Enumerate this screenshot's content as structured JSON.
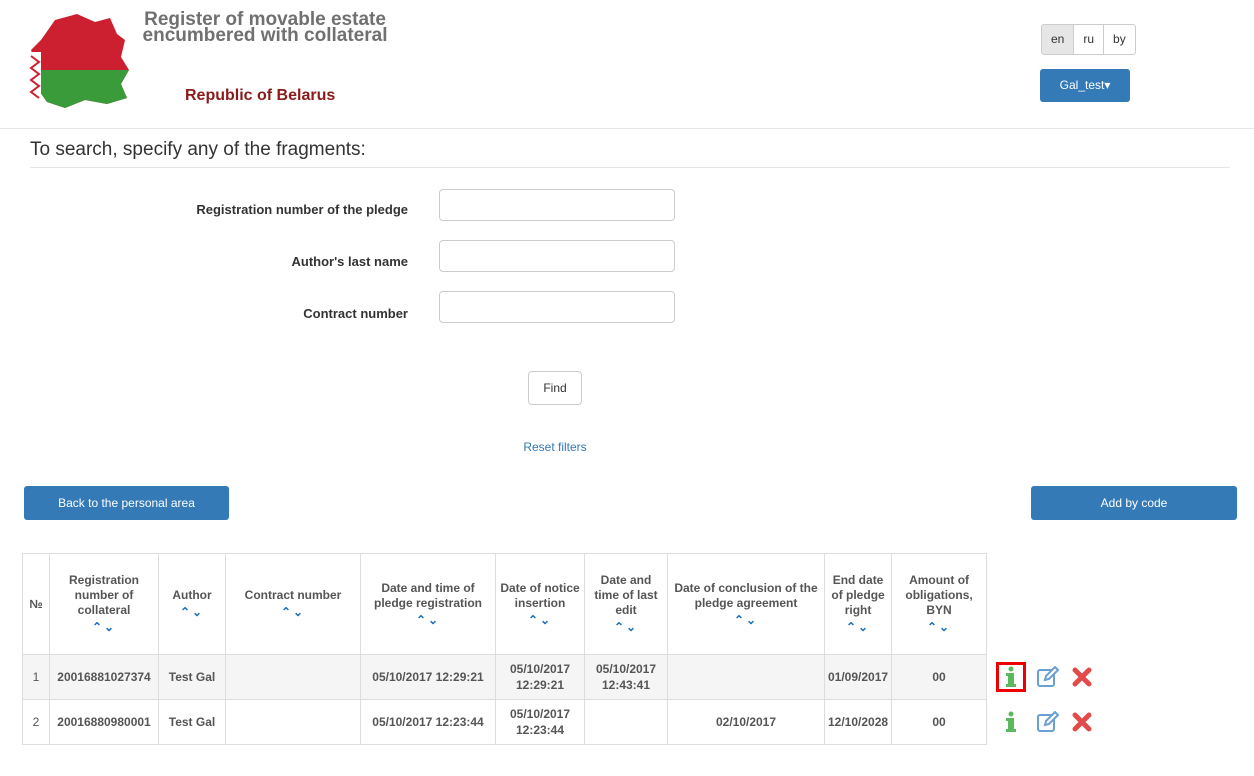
{
  "header": {
    "title": "Register of movable estate encumbered with collateral",
    "subtitle": "Republic of Belarus",
    "languages": [
      "en",
      "ru",
      "by"
    ],
    "active_language": "en",
    "user_button": "Gal_test▾"
  },
  "search": {
    "heading": "To search, specify any of the fragments:",
    "fields": [
      {
        "label": "Registration number of the pledge",
        "value": ""
      },
      {
        "label": "Author's last name",
        "value": ""
      },
      {
        "label": "Contract number",
        "value": ""
      }
    ],
    "find_label": "Find",
    "reset_label": "Reset filters"
  },
  "actions": {
    "back_label": "Back to the personal area",
    "add_label": "Add by code"
  },
  "table": {
    "columns": [
      "№",
      "Registration number of collateral",
      "Author",
      "Contract number",
      "Date and time of pledge registration",
      "Date of notice insertion",
      "Date and time of last edit",
      "Date of conclusion of the pledge agreement",
      "End date of pledge right",
      "Amount of obligations, BYN"
    ],
    "sort_glyph": "⌃⌄",
    "rows": [
      {
        "no": "1",
        "reg_number": "20016881027374",
        "author": "Test Gal",
        "contract_number": "",
        "reg_date": "05/10/2017 12:29:21",
        "notice_date": "05/10/2017 12:29:21",
        "edit_date": "05/10/2017 12:43:41",
        "conclusion_date": "",
        "end_date": "01/09/2017",
        "amount": "00"
      },
      {
        "no": "2",
        "reg_number": "20016880980001",
        "author": "Test Gal",
        "contract_number": "",
        "reg_date": "05/10/2017 12:23:44",
        "notice_date": "05/10/2017 12:23:44",
        "edit_date": "",
        "conclusion_date": "02/10/2017",
        "end_date": "12/10/2028",
        "amount": "00"
      }
    ],
    "row_icons": [
      "info-icon",
      "edit-icon",
      "delete-icon"
    ]
  },
  "colors": {
    "primary": "#337ab7",
    "title_red": "#8b1a1a",
    "info_green": "#5cb85c",
    "delete_red": "#e24b4b",
    "highlight": "#e00000"
  }
}
